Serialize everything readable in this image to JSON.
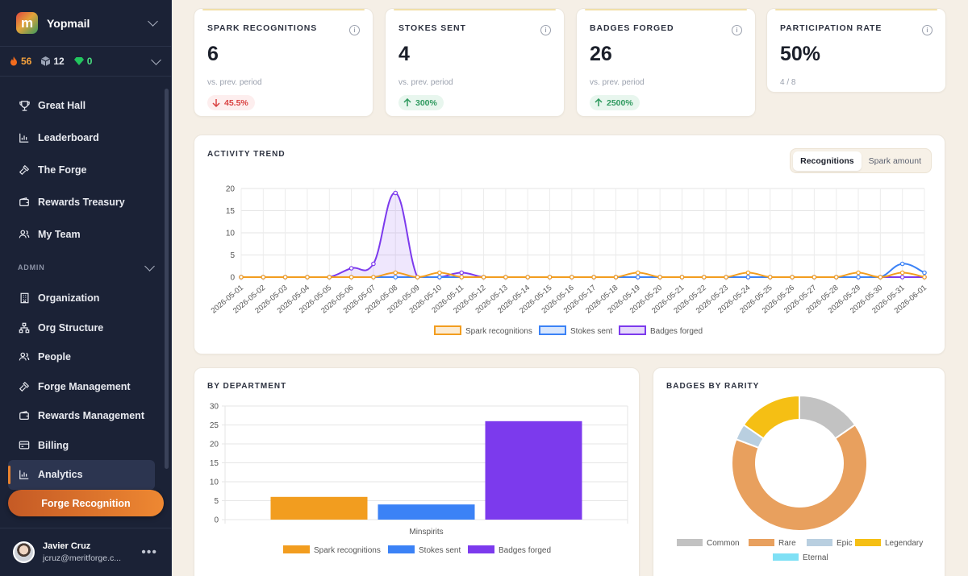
{
  "app": {
    "workspace": "Yopmail",
    "logo_letter": "m",
    "stats": {
      "fire": "56",
      "gems": "12",
      "emerald": "0"
    }
  },
  "nav": {
    "main": [
      {
        "label": "Great Hall",
        "icon": "trophy-icon"
      },
      {
        "label": "Leaderboard",
        "icon": "bar-chart-icon"
      },
      {
        "label": "The Forge",
        "icon": "hammer-icon"
      },
      {
        "label": "Rewards Treasury",
        "icon": "wallet-icon"
      },
      {
        "label": "My Team",
        "icon": "team-icon"
      }
    ],
    "admin_label": "ADMIN",
    "admin": [
      {
        "label": "Organization",
        "icon": "building-icon"
      },
      {
        "label": "Org Structure",
        "icon": "org-structure-icon"
      },
      {
        "label": "People",
        "icon": "people-icon"
      },
      {
        "label": "Forge Management",
        "icon": "hammer-icon"
      },
      {
        "label": "Rewards Management",
        "icon": "wallet-icon"
      },
      {
        "label": "Billing",
        "icon": "credit-card-icon"
      },
      {
        "label": "Analytics",
        "icon": "bar-chart-icon",
        "active": true
      }
    ],
    "cta": "Forge Recognition"
  },
  "user": {
    "name": "Javier Cruz",
    "email": "jcruz@meritforge.c..."
  },
  "kpis": [
    {
      "label": "SPARK RECOGNITIONS",
      "value": "6",
      "sub": "vs. prev. period",
      "delta": "45.5%",
      "direction": "down"
    },
    {
      "label": "STOKES SENT",
      "value": "4",
      "sub": "vs. prev. period",
      "delta": "300%",
      "direction": "up"
    },
    {
      "label": "BADGES FORGED",
      "value": "26",
      "sub": "vs. prev. period",
      "delta": "2500%",
      "direction": "up"
    },
    {
      "label": "PARTICIPATION RATE",
      "value": "50%",
      "sub": "4 / 8"
    }
  ],
  "activity": {
    "title": "ACTIVITY TREND",
    "toggle": [
      "Recognitions",
      "Spark amount"
    ],
    "toggle_selected": "Recognitions"
  },
  "department": {
    "title": "BY DEPARTMENT"
  },
  "rarity": {
    "title": "BADGES BY RARITY"
  },
  "colors": {
    "spark": "#f29d1f",
    "stokes": "#3b82f6",
    "badges": "#7c3aed",
    "accent": "#e8822e"
  },
  "chart_data": [
    {
      "type": "line",
      "title": "ACTIVITY TREND",
      "x": [
        "2026-05-01",
        "2026-05-02",
        "2026-05-03",
        "2026-05-04",
        "2026-05-05",
        "2026-05-06",
        "2026-05-07",
        "2026-05-08",
        "2026-05-09",
        "2026-05-10",
        "2026-05-11",
        "2026-05-12",
        "2026-05-13",
        "2026-05-14",
        "2026-05-15",
        "2026-05-16",
        "2026-05-17",
        "2026-05-18",
        "2026-05-19",
        "2026-05-20",
        "2026-05-21",
        "2026-05-22",
        "2026-05-23",
        "2026-05-24",
        "2026-05-25",
        "2026-05-26",
        "2026-05-27",
        "2026-05-28",
        "2026-05-29",
        "2026-05-30",
        "2026-05-31",
        "2026-06-01"
      ],
      "ylim": [
        0,
        20
      ],
      "yticks": [
        0,
        5,
        10,
        15,
        20
      ],
      "grid": true,
      "legend": "bottom",
      "series": [
        {
          "name": "Spark recognitions",
          "values": [
            0,
            0,
            0,
            0,
            0,
            0,
            0,
            1,
            0,
            1,
            0,
            0,
            0,
            0,
            0,
            0,
            0,
            0,
            1,
            0,
            0,
            0,
            0,
            1,
            0,
            0,
            0,
            0,
            1,
            0,
            1,
            0
          ]
        },
        {
          "name": "Stokes sent",
          "values": [
            0,
            0,
            0,
            0,
            0,
            0,
            0,
            0,
            0,
            0,
            0,
            0,
            0,
            0,
            0,
            0,
            0,
            0,
            0,
            0,
            0,
            0,
            0,
            0,
            0,
            0,
            0,
            0,
            0,
            0,
            3,
            1
          ]
        },
        {
          "name": "Badges forged",
          "values": [
            0,
            0,
            0,
            0,
            0,
            2,
            3,
            19,
            0,
            0,
            1,
            0,
            0,
            0,
            0,
            0,
            0,
            0,
            0,
            0,
            0,
            0,
            0,
            0,
            0,
            0,
            0,
            0,
            0,
            0,
            0,
            0
          ]
        }
      ]
    },
    {
      "type": "bar",
      "title": "BY DEPARTMENT",
      "categories": [
        "Minspirits"
      ],
      "ylim": [
        0,
        30
      ],
      "yticks": [
        0,
        5,
        10,
        15,
        20,
        25,
        30
      ],
      "grid": true,
      "legend": "bottom",
      "series": [
        {
          "name": "Spark recognitions",
          "values": [
            6
          ]
        },
        {
          "name": "Stokes sent",
          "values": [
            4
          ]
        },
        {
          "name": "Badges forged",
          "values": [
            26
          ]
        }
      ]
    },
    {
      "type": "pie",
      "title": "BADGES BY RARITY",
      "legend": "bottom",
      "slices": [
        {
          "name": "Common",
          "value": 4,
          "color": "#c2c2c2"
        },
        {
          "name": "Rare",
          "value": 17,
          "color": "#e8a05e"
        },
        {
          "name": "Epic",
          "value": 1,
          "color": "#b9cfe0"
        },
        {
          "name": "Legendary",
          "value": 4,
          "color": "#f5bf14"
        },
        {
          "name": "Eternal",
          "value": 0,
          "color": "#7fe0f5"
        }
      ]
    }
  ]
}
